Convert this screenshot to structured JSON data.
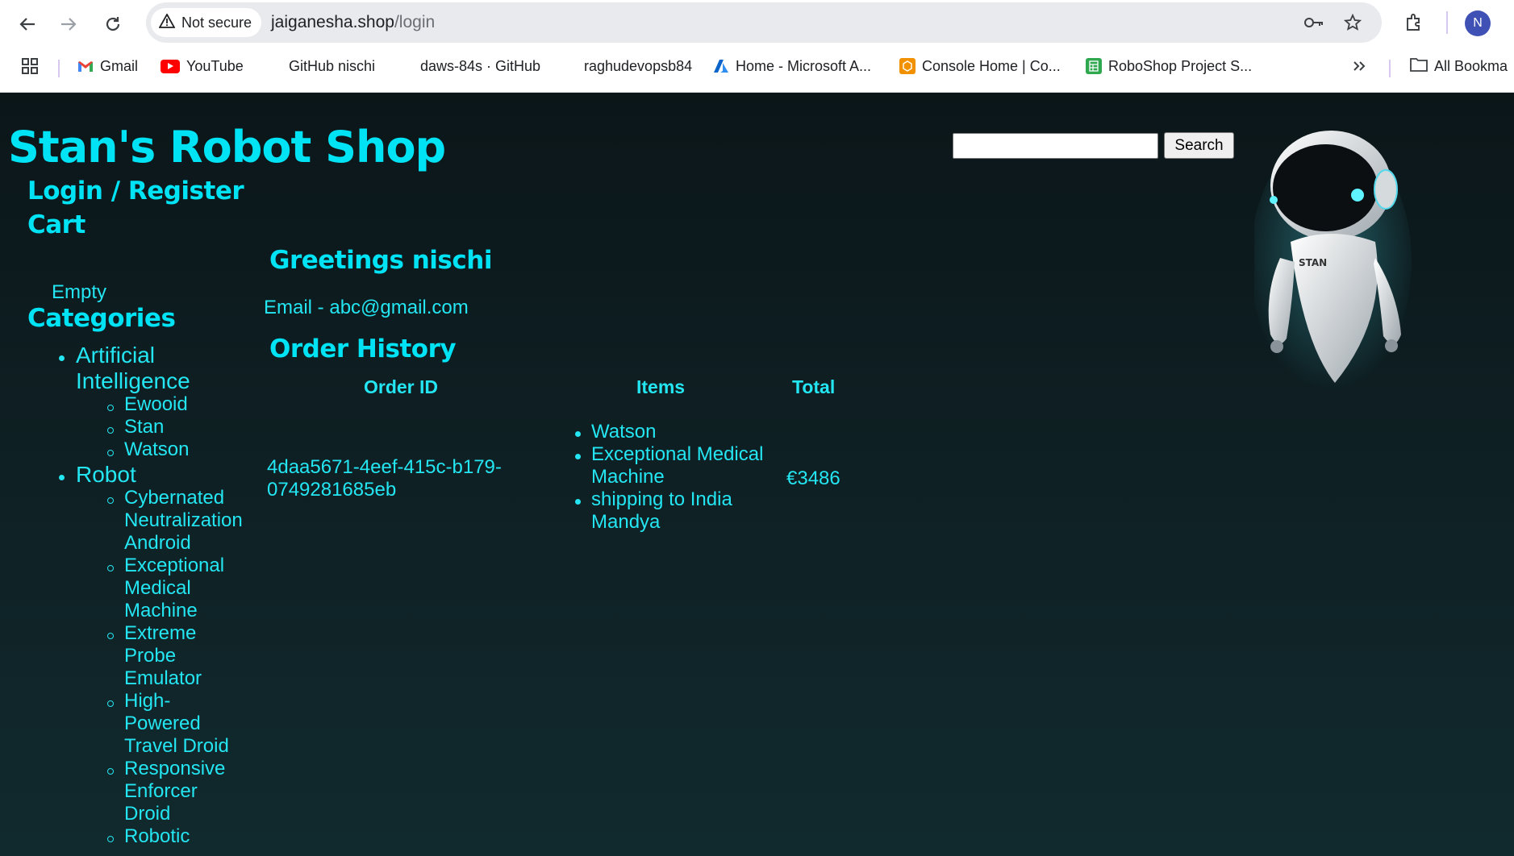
{
  "browser": {
    "security_label": "Not secure",
    "url_host": "jaiganesha.shop",
    "url_path": "/login",
    "profile_initial": "N",
    "bookmarks": [
      {
        "label": "Gmail"
      },
      {
        "label": "YouTube"
      },
      {
        "label": "GitHub nischi"
      },
      {
        "label": "daws-84s · GitHub"
      },
      {
        "label": "raghudevopsb84"
      },
      {
        "label": "Home - Microsoft A..."
      },
      {
        "label": "Console Home | Co..."
      },
      {
        "label": "RoboShop Project S..."
      }
    ],
    "all_bookmarks_label": "All Bookma"
  },
  "site": {
    "title": "Stan's Robot Shop",
    "search_button": "Search",
    "search_value": ""
  },
  "sidebar": {
    "login_register": "Login / Register",
    "cart_heading": "Cart",
    "cart_status": "Empty",
    "categories_heading": "Categories",
    "categories": [
      {
        "name_line1": "Artificial",
        "name_line2": "Intelligence",
        "items": [
          "Ewooid",
          "Stan",
          "Watson"
        ]
      },
      {
        "name": "Robot",
        "items": [
          [
            "Cybernated",
            "Neutralization",
            "Android"
          ],
          [
            "Exceptional",
            "Medical",
            "Machine"
          ],
          [
            "Extreme",
            "Probe",
            "Emulator"
          ],
          [
            "High-",
            "Powered",
            "Travel Droid"
          ],
          [
            "Responsive",
            "Enforcer",
            "Droid"
          ],
          [
            "Robotic"
          ]
        ]
      }
    ]
  },
  "main": {
    "greeting": "Greetings nischi",
    "email": "Email - abc@gmail.com",
    "order_history_heading": "Order History",
    "table_headers": {
      "order_id": "Order ID",
      "items": "Items",
      "total": "Total"
    },
    "orders": [
      {
        "order_id_line1": "4daa5671-4eef-415c-b179-",
        "order_id_line2": "0749281685eb",
        "items": [
          "Watson",
          "Exceptional Medical",
          "Machine",
          "shipping to India",
          "Mandya"
        ],
        "total": "€3486"
      }
    ]
  },
  "colors": {
    "accent": "#00e3f5",
    "text": "#24e6f2",
    "background": "#0c1a1e"
  }
}
